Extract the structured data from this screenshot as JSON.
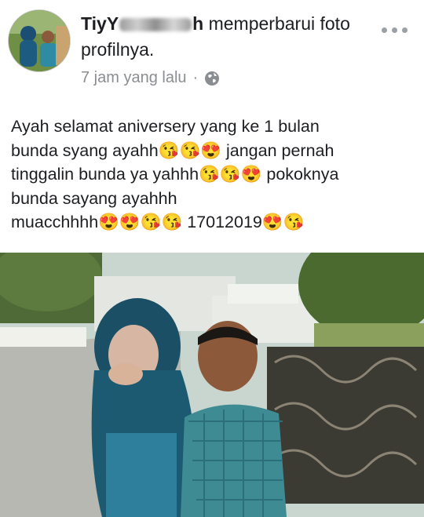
{
  "post": {
    "author_name_visible": "TiyY",
    "author_name_tail": "h",
    "action_text": "memperbarui foto profilnya.",
    "timestamp": "7 jam yang lalu",
    "separator": "·",
    "privacy_icon": "globe-icon",
    "more_icon": "more-options-icon",
    "body_text": "Ayah selamat aniversery yang ke 1 bulan\nbunda syang ayahh😘😘😍 jangan pernah\ntinggalin bunda ya yahhh😘😘😍 pokoknya\nbunda sayang ayahhh\nmuacchhhh😍😍😘😘 17012019😍😘"
  },
  "colors": {
    "secondary_text": "#8a8d91",
    "primary_text": "#1c1e21",
    "background": "#ffffff"
  }
}
